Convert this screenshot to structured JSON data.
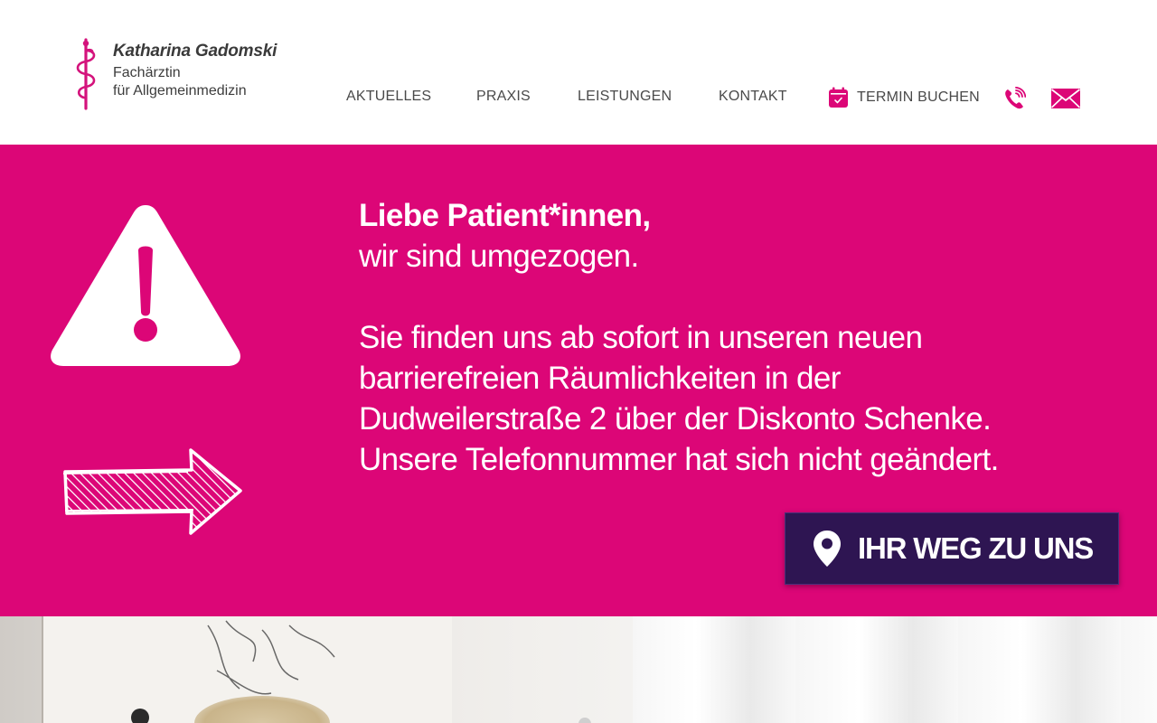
{
  "header": {
    "logo": {
      "name": "Katharina Gadomski",
      "subtitle_line1": "Fachärztin",
      "subtitle_line2": "für Allgemeinmedizin",
      "icon": "aesculapius-staff-icon"
    },
    "nav": {
      "items": [
        {
          "label": "AKTUELLES"
        },
        {
          "label": "PRAXIS"
        },
        {
          "label": "LEISTUNGEN"
        },
        {
          "label": "KONTAKT"
        }
      ],
      "termin": {
        "label": "TERMIN BUCHEN",
        "icon": "calendar-check-icon"
      },
      "phone_icon": "phone-icon",
      "mail_icon": "mail-icon"
    }
  },
  "banner": {
    "background_color": "#dc0677",
    "greeting": "Liebe Patient*innen,",
    "line1": "wir sind umgezogen.",
    "body_lines": [
      "Sie finden uns ab sofort in unseren neuen",
      "barrierefreien Räumlichkeiten in der",
      "Dudweilerstraße 2 über der Diskonto Schenke.",
      "Unsere Telefonnummer hat sich nicht geändert."
    ],
    "warning_icon": "warning-triangle-icon",
    "arrow_icon": "hatched-arrow-right-icon",
    "cta": {
      "label": "IHR WEG ZU UNS",
      "icon": "location-pin-icon",
      "background_color": "#2e1552"
    }
  },
  "colors": {
    "accent": "#dc0677",
    "nav_text": "#4a4a4a",
    "cta_bg": "#2e1552"
  }
}
